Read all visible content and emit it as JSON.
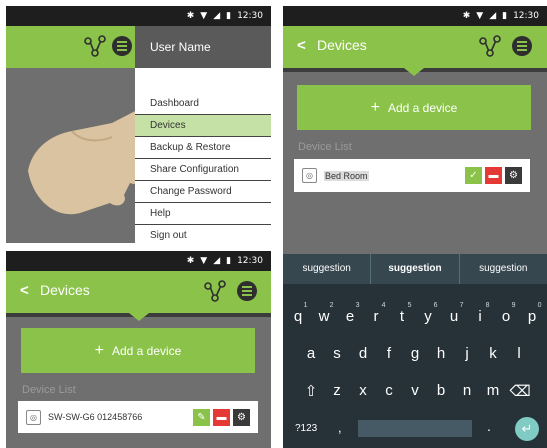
{
  "status": {
    "bluetooth": "✱",
    "wifi": "▼",
    "signal": "◢",
    "battery": "▮",
    "time": "12:30"
  },
  "panel1": {
    "user_name": "User Name",
    "menu": [
      {
        "label": "Dashboard",
        "highlighted": false
      },
      {
        "label": "Devices",
        "highlighted": true
      },
      {
        "label": "Backup & Restore",
        "highlighted": false
      },
      {
        "label": "Share Configuration",
        "highlighted": false
      },
      {
        "label": "Change Password",
        "highlighted": false
      },
      {
        "label": "Help",
        "highlighted": false
      },
      {
        "label": "Sign out",
        "highlighted": false
      }
    ]
  },
  "panel2": {
    "back": "<",
    "title": "Devices",
    "add_label": "Add a device",
    "plus": "+",
    "section": "Device List",
    "device": {
      "name": "SW-SW-G6 012458766"
    }
  },
  "panel3": {
    "back": "<",
    "title": "Devices",
    "add_label": "Add a device",
    "plus": "+",
    "section": "Device List",
    "device": {
      "value": "Bed Room"
    },
    "suggestions": [
      "suggestion",
      "suggestion",
      "suggestion"
    ],
    "keys_row1": [
      {
        "k": "q",
        "n": "1"
      },
      {
        "k": "w",
        "n": "2"
      },
      {
        "k": "e",
        "n": "3"
      },
      {
        "k": "r",
        "n": "4"
      },
      {
        "k": "t",
        "n": "5"
      },
      {
        "k": "y",
        "n": "6"
      },
      {
        "k": "u",
        "n": "7"
      },
      {
        "k": "i",
        "n": "8"
      },
      {
        "k": "o",
        "n": "9"
      },
      {
        "k": "p",
        "n": "0"
      }
    ],
    "keys_row2": [
      "a",
      "s",
      "d",
      "f",
      "g",
      "h",
      "j",
      "k",
      "l"
    ],
    "keys_row3": [
      "⇧",
      "z",
      "x",
      "c",
      "v",
      "b",
      "n",
      "m",
      "⌫"
    ],
    "key_sym": "?123",
    "key_comma": ",",
    "key_period": ".",
    "key_enter": "↵"
  },
  "colors": {
    "accent": "#8bc34a",
    "background": "#6f6f6f",
    "delete": "#e53935"
  }
}
